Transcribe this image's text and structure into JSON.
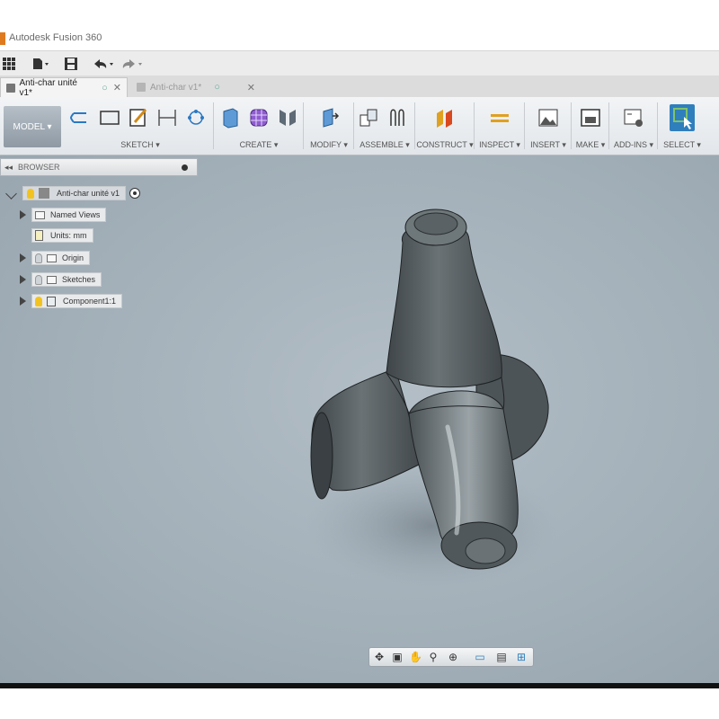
{
  "app": {
    "title": "Autodesk Fusion 360"
  },
  "tabs": [
    {
      "label": "Anti-char unité v1*",
      "active": true
    },
    {
      "label": "Anti-char v1*",
      "active": false
    }
  ],
  "ribbon": {
    "workspace": "MODEL ▾",
    "groups": [
      {
        "label": "SKETCH ▾"
      },
      {
        "label": "CREATE ▾"
      },
      {
        "label": "MODIFY ▾"
      },
      {
        "label": "ASSEMBLE ▾"
      },
      {
        "label": "CONSTRUCT ▾"
      },
      {
        "label": "INSPECT ▾"
      },
      {
        "label": "INSERT ▾"
      },
      {
        "label": "MAKE ▾"
      },
      {
        "label": "ADD-INS ▾"
      },
      {
        "label": "SELECT ▾"
      }
    ]
  },
  "browser": {
    "header": "BROWSER",
    "root": "Anti-char unité v1",
    "items": [
      {
        "label": "Named Views"
      },
      {
        "label": "Units: mm"
      },
      {
        "label": "Origin"
      },
      {
        "label": "Sketches"
      },
      {
        "label": "Component1:1"
      }
    ]
  },
  "colors": {
    "accent": "#e07a1f",
    "canvas": "#a7b3bc",
    "model": "#5b6266",
    "ribbon": "#e8ebee"
  },
  "icons": [
    "grid-icon",
    "file-icon",
    "save-icon",
    "undo-icon",
    "redo-icon",
    "lightbulb-icon",
    "folder-icon",
    "orbit-icon",
    "pan-icon",
    "zoom-icon",
    "display-icon"
  ]
}
